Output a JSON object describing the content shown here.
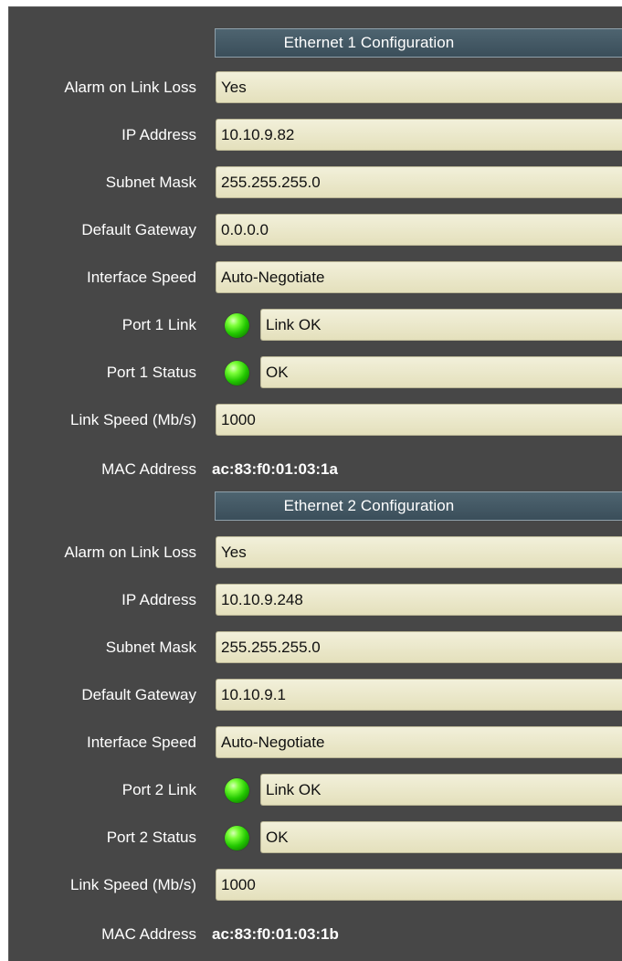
{
  "eth1": {
    "header": "Ethernet 1 Configuration",
    "alarm_label": "Alarm on Link Loss",
    "alarm_value": "Yes",
    "ip_label": "IP Address",
    "ip_value": "10.10.9.82",
    "subnet_label": "Subnet Mask",
    "subnet_value": "255.255.255.0",
    "gateway_label": "Default Gateway",
    "gateway_value": "0.0.0.0",
    "speed_label": "Interface Speed",
    "speed_value": "Auto-Negotiate",
    "port_link_label": "Port 1 Link",
    "port_link_value": "Link OK",
    "port_status_label": "Port 1 Status",
    "port_status_value": "OK",
    "link_speed_label": "Link Speed (Mb/s)",
    "link_speed_value": "1000",
    "mac_label": "MAC Address",
    "mac_value": "ac:83:f0:01:03:1a"
  },
  "eth2": {
    "header": "Ethernet 2 Configuration",
    "alarm_label": "Alarm on Link Loss",
    "alarm_value": "Yes",
    "ip_label": "IP Address",
    "ip_value": "10.10.9.248",
    "subnet_label": "Subnet Mask",
    "subnet_value": "255.255.255.0",
    "gateway_label": "Default Gateway",
    "gateway_value": "10.10.9.1",
    "speed_label": "Interface Speed",
    "speed_value": "Auto-Negotiate",
    "port_link_label": "Port 2 Link",
    "port_link_value": "Link OK",
    "port_status_label": "Port 2 Status",
    "port_status_value": "OK",
    "link_speed_label": "Link Speed (Mb/s)",
    "link_speed_value": "1000",
    "mac_label": "MAC Address",
    "mac_value": "ac:83:f0:01:03:1b"
  },
  "status": {
    "led_color": "#22c800",
    "led_icon": "green-status-led-icon"
  },
  "theme": {
    "panel_bg": "#474747",
    "header_bg": "#3a4e5a",
    "field_bg": "#ece8c9"
  }
}
